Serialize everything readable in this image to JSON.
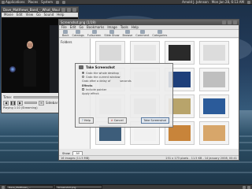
{
  "top_panel": {
    "menus": [
      "Applications",
      "Places",
      "System"
    ],
    "user": "Arnold J. Johnson",
    "datetime": "Mon Jan 28, 6:13 AM"
  },
  "video_player": {
    "title": "Dave_Matthews_Band_-_What_Would_You_Say",
    "menu": [
      "Movie",
      "Edit",
      "View",
      "Go",
      "Sound",
      "Help"
    ],
    "time_label": "Time:",
    "subtitle_label": "Sidebar",
    "status": "Playing",
    "status_detail": "1:10 (Streaming)"
  },
  "image_viewer": {
    "title": "Screenshot.png (1/19)",
    "menu": [
      "File",
      "Edit",
      "Go",
      "Bookmarks",
      "Image",
      "Tools",
      "Help"
    ],
    "toolbar": [
      "Back",
      "Catalogs",
      "Fullscreen",
      "Slide Show",
      "Browse",
      "Comment",
      "Categories"
    ],
    "sidebar_label": "Folders",
    "show_label": "Show:",
    "show_value": "All",
    "status_left": "16 images (11.5 MB)",
    "status_right": "231 x 173 pixels - 11.5 KB - 14 January 2008, 00:41"
  },
  "screenshot_dialog": {
    "title": "Take Screenshot",
    "grab_label": "Grab the whole desktop",
    "grab_window": "Grab the current window",
    "grab_delay": "Grab after a delay of",
    "delay_unit": "seconds",
    "effects_label": "Effects",
    "include_pointer": "Include pointer",
    "apply_effect": "Apply effect:",
    "help_button": "Help",
    "cancel_button": "Cancel",
    "take_button": "Take Screenshot"
  },
  "bottom_panel": {
    "tasks": [
      "Dave_Matthews_...",
      "Screenshot.png"
    ]
  },
  "thumb_colors": [
    "#d9d9d9",
    "#e6e6e6",
    "#2a2a2a",
    "#dcdcdc",
    "#cfcfcf",
    "#dedede",
    "#1e3f7a",
    "#bfbfbf",
    "#d4d4d4",
    "#c7c7c7",
    "#b8a46b",
    "#2b5b9a",
    "#3d5d7a",
    "#f1f1f1",
    "#c8843a",
    "#d7a66a"
  ]
}
